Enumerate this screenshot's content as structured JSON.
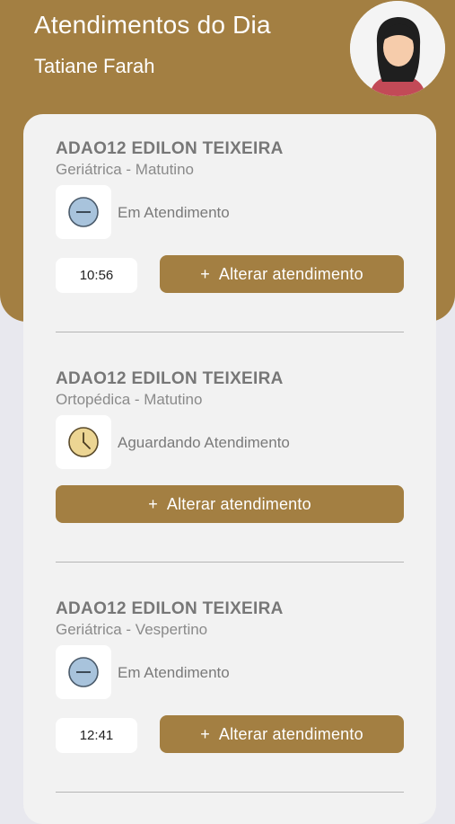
{
  "header": {
    "title": "Atendimentos do Dia",
    "user_name": "Tatiane Farah"
  },
  "colors": {
    "brand": "#a37f42",
    "status_in_progress": "#a8c3dc",
    "status_waiting": "#ecd593"
  },
  "appointments": [
    {
      "patient": "ADAO12 EDILON TEIXEIRA",
      "specialty": "Geriátrica - Matutino",
      "status": "Em Atendimento",
      "status_icon": "in-progress-icon",
      "time": "10:56",
      "action_label": "Alterar atendimento",
      "action_icon": "+"
    },
    {
      "patient": "ADAO12 EDILON TEIXEIRA",
      "specialty": "Ortopédica - Matutino",
      "status": "Aguardando Atendimento",
      "status_icon": "clock-icon",
      "time": "",
      "action_label": "Alterar atendimento",
      "action_icon": "+"
    },
    {
      "patient": "ADAO12 EDILON TEIXEIRA",
      "specialty": "Geriátrica - Vespertino",
      "status": "Em Atendimento",
      "status_icon": "in-progress-icon",
      "time": "12:41",
      "action_label": "Alterar atendimento",
      "action_icon": "+"
    }
  ]
}
